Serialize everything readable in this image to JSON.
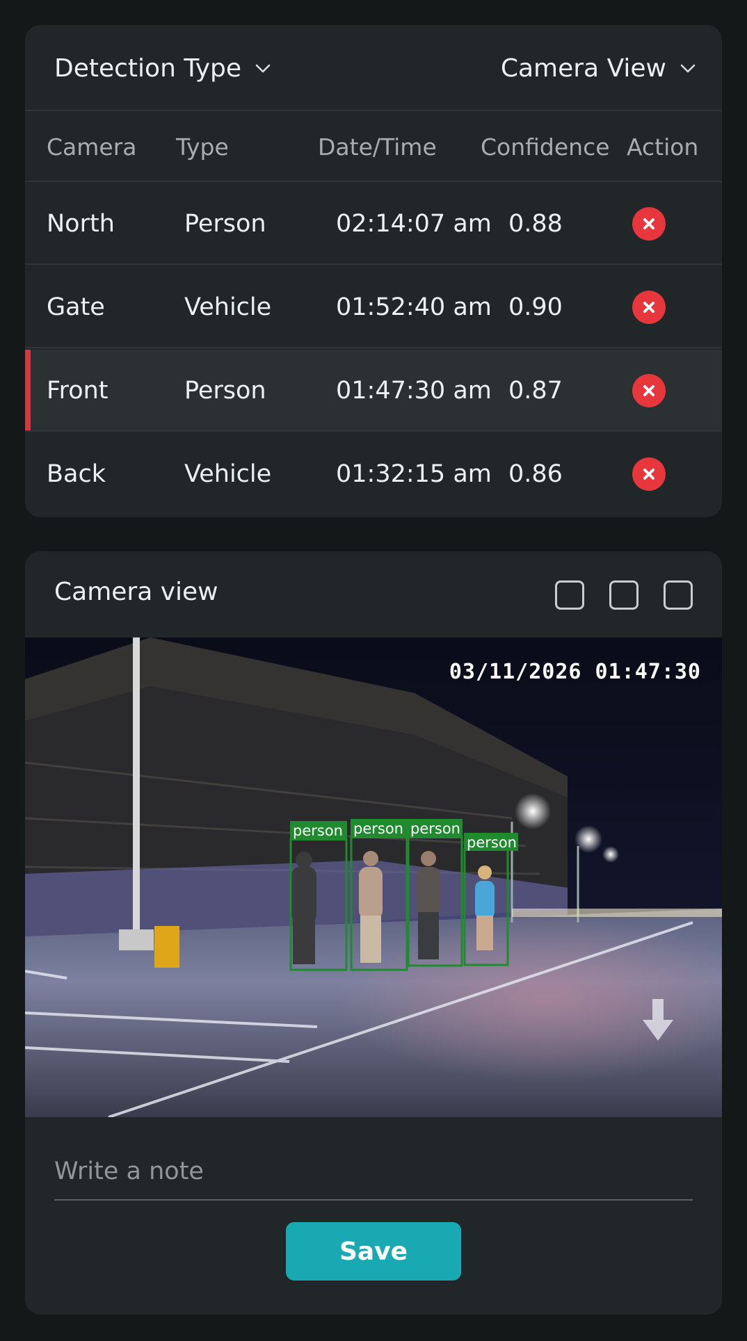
{
  "filters": {
    "detection_type_label": "Detection Type",
    "camera_view_label": "Camera View"
  },
  "table": {
    "headers": [
      "Camera",
      "Type",
      "Date/Time",
      "Confidence",
      "Action"
    ],
    "rows": [
      {
        "camera": "North",
        "type": "Person",
        "time": "02:14:07 am",
        "confidence": "0.88",
        "selected": false
      },
      {
        "camera": "Gate",
        "type": "Vehicle",
        "time": "01:52:40 am",
        "confidence": "0.90",
        "selected": false
      },
      {
        "camera": "Front",
        "type": "Person",
        "time": "01:47:30 am",
        "confidence": "0.87",
        "selected": true
      },
      {
        "camera": "Back",
        "type": "Vehicle",
        "time": "01:32:15 am",
        "confidence": "0.86",
        "selected": false
      }
    ],
    "action_icon": "close-icon"
  },
  "camera": {
    "title": "Camera view",
    "timestamp": "03/11/2026 01:47:30",
    "detections": [
      "person",
      "person",
      "person",
      "person"
    ],
    "layout_icons": [
      "square-outline-icon",
      "square-outline-icon",
      "square-outline-icon"
    ]
  },
  "note": {
    "placeholder": "Write a note"
  },
  "save_label": "Save",
  "colors": {
    "background": "#151819",
    "card": "#212628",
    "accent": "#18a9b3",
    "delete": "#e8363d",
    "selected_marker": "#d33a3f",
    "detection_box": "#1f8a2e"
  }
}
